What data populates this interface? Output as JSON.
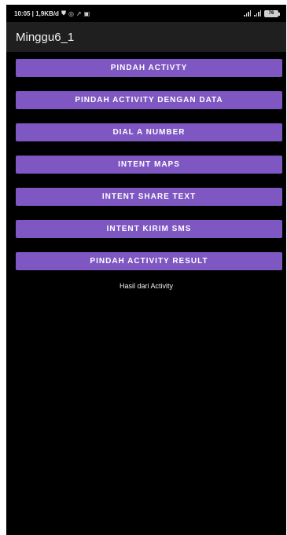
{
  "statusbar": {
    "time_speed": "10:05 | 1,9KB/d",
    "icons_left": [
      "shield-icon",
      "whatsapp-icon",
      "notification-icon",
      "instagram-icon"
    ],
    "battery": "76"
  },
  "appbar": {
    "title": "Minggu6_1"
  },
  "buttons": [
    {
      "label": "PINDAH ACTIVTY"
    },
    {
      "label": "PINDAH ACTIVITY DENGAN DATA"
    },
    {
      "label": "DIAL A NUMBER"
    },
    {
      "label": "INTENT MAPS"
    },
    {
      "label": "INTENT SHARE TEXT"
    },
    {
      "label": "INTENT KIRIM SMS"
    },
    {
      "label": "PINDAH ACTIVITY RESULT"
    }
  ],
  "result_text": "Hasil dari Activity",
  "colors": {
    "button": "#7e57c2",
    "appbar": "#1f1f1f",
    "background": "#000000"
  }
}
